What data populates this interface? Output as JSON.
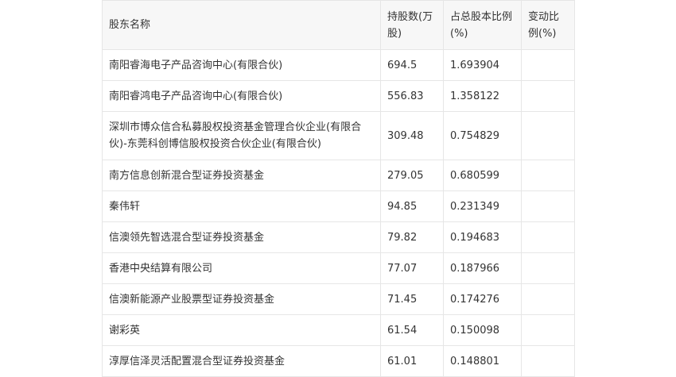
{
  "table": {
    "headers": [
      "股东名称",
      "持股数(万股)",
      "占总股本比例(%)",
      "变动比例(%)"
    ],
    "rows": [
      {
        "name": "南阳睿海电子产品咨询中心(有限合伙)",
        "shares": "694.5",
        "ratio": "1.693904",
        "change": ""
      },
      {
        "name": "南阳睿鸿电子产品咨询中心(有限合伙)",
        "shares": "556.83",
        "ratio": "1.358122",
        "change": ""
      },
      {
        "name": "深圳市博众信合私募股权投资基金管理合伙企业(有限合伙)-东莞科创博信股权投资合伙企业(有限合伙)",
        "shares": "309.48",
        "ratio": "0.754829",
        "change": ""
      },
      {
        "name": "南方信息创新混合型证券投资基金",
        "shares": "279.05",
        "ratio": "0.680599",
        "change": ""
      },
      {
        "name": "秦伟轩",
        "shares": "94.85",
        "ratio": "0.231349",
        "change": ""
      },
      {
        "name": "信澳领先智选混合型证券投资基金",
        "shares": "79.82",
        "ratio": "0.194683",
        "change": ""
      },
      {
        "name": "香港中央结算有限公司",
        "shares": "77.07",
        "ratio": "0.187966",
        "change": ""
      },
      {
        "name": "信澳新能源产业股票型证券投资基金",
        "shares": "71.45",
        "ratio": "0.174276",
        "change": ""
      },
      {
        "name": "谢彩英",
        "shares": "61.54",
        "ratio": "0.150098",
        "change": ""
      },
      {
        "name": "淳厚信泽灵活配置混合型证券投资基金",
        "shares": "61.01",
        "ratio": "0.148801",
        "change": ""
      }
    ]
  }
}
